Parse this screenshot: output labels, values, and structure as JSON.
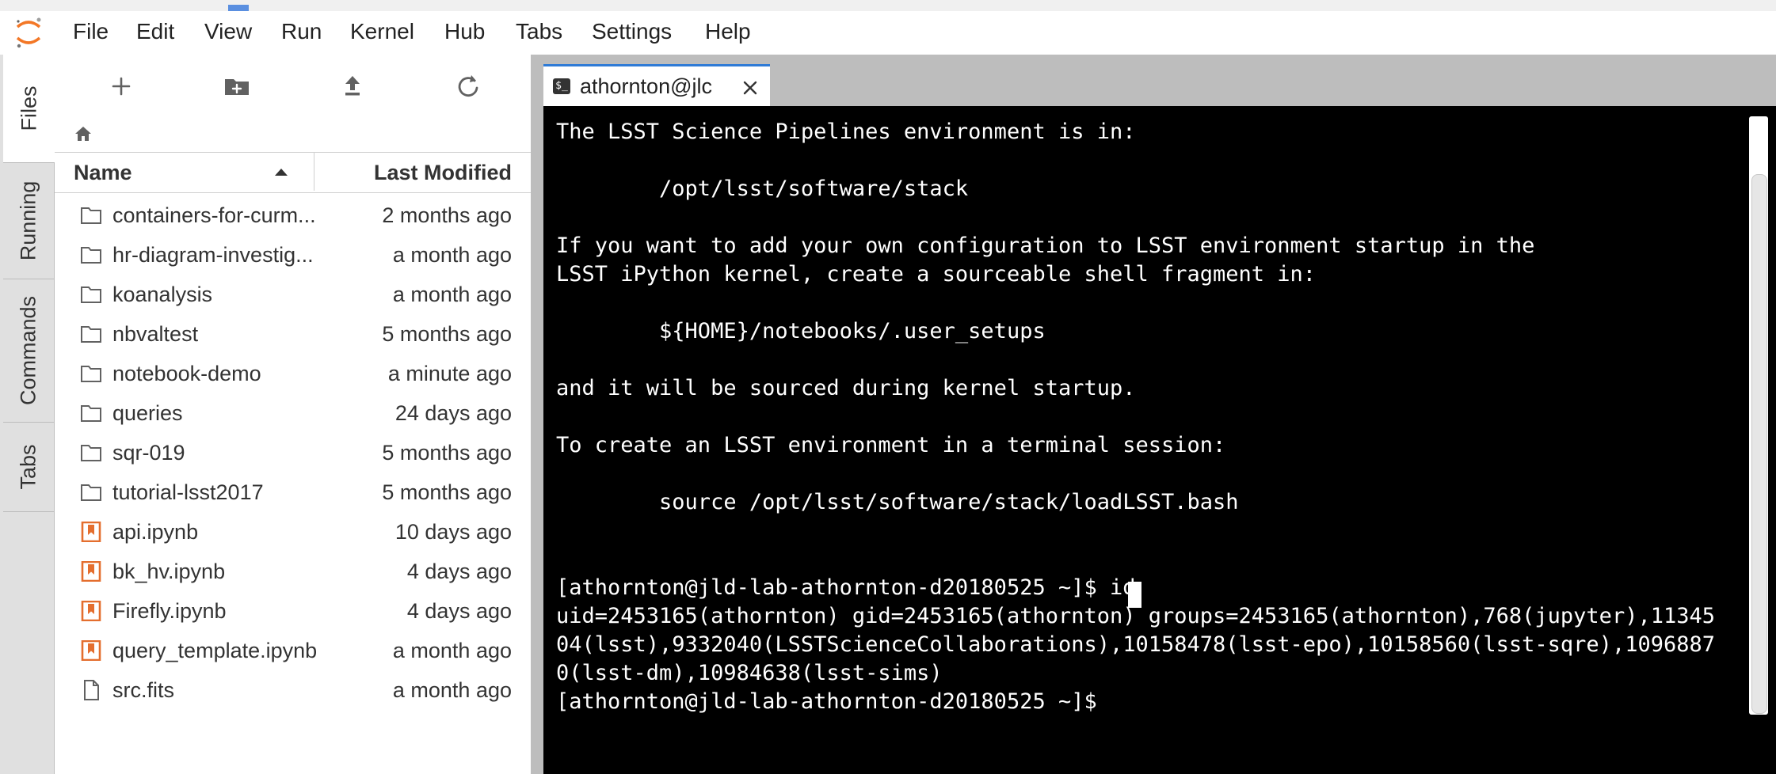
{
  "menubar": {
    "items": [
      "File",
      "Edit",
      "View",
      "Run",
      "Kernel",
      "Hub",
      "Tabs",
      "Settings",
      "Help"
    ]
  },
  "sidebar": {
    "tabs": [
      "Files",
      "Running",
      "Commands",
      "Tabs"
    ]
  },
  "file_browser": {
    "toolbar_icons": [
      "plus-icon",
      "new-folder-icon",
      "upload-icon",
      "refresh-icon"
    ],
    "columns": {
      "name": "Name",
      "modified": "Last Modified"
    },
    "files": [
      {
        "name": "containers-for-curm...",
        "modified": "2 months ago",
        "type": "folder"
      },
      {
        "name": "hr-diagram-investig...",
        "modified": "a month ago",
        "type": "folder"
      },
      {
        "name": "koanalysis",
        "modified": "a month ago",
        "type": "folder"
      },
      {
        "name": "nbvaltest",
        "modified": "5 months ago",
        "type": "folder"
      },
      {
        "name": "notebook-demo",
        "modified": "a minute ago",
        "type": "folder"
      },
      {
        "name": "queries",
        "modified": "24 days ago",
        "type": "folder"
      },
      {
        "name": "sqr-019",
        "modified": "5 months ago",
        "type": "folder"
      },
      {
        "name": "tutorial-lsst2017",
        "modified": "5 months ago",
        "type": "folder"
      },
      {
        "name": "api.ipynb",
        "modified": "10 days ago",
        "type": "notebook"
      },
      {
        "name": "bk_hv.ipynb",
        "modified": "4 days ago",
        "type": "notebook"
      },
      {
        "name": "Firefly.ipynb",
        "modified": "4 days ago",
        "type": "notebook"
      },
      {
        "name": "query_template.ipynb",
        "modified": "a month ago",
        "type": "notebook"
      },
      {
        "name": "src.fits",
        "modified": "a month ago",
        "type": "file"
      }
    ]
  },
  "doc_tab": {
    "label": "athornton@jlc"
  },
  "terminal": {
    "lines": [
      "The LSST Science Pipelines environment is in:",
      "",
      "        /opt/lsst/software/stack",
      "",
      "If you want to add your own configuration to LSST environment startup in the",
      "LSST iPython kernel, create a sourceable shell fragment in:",
      "",
      "        ${HOME}/notebooks/.user_setups",
      "",
      "and it will be sourced during kernel startup.",
      "",
      "To create an LSST environment in a terminal session:",
      "",
      "        source /opt/lsst/software/stack/loadLSST.bash",
      "",
      "",
      "[athornton@jld-lab-athornton-d20180525 ~]$ id",
      "uid=2453165(athornton) gid=2453165(athornton) groups=2453165(athornton),768(jupyter),11345",
      "04(lsst),9332040(LSSTScienceCollaborations),10158478(lsst-epo),10158560(lsst-sqre),1096887",
      "0(lsst-dm),10984638(lsst-sims)",
      "[athornton@jld-lab-athornton-d20180525 ~]$ "
    ]
  },
  "colors": {
    "accent": "#2f7bd6",
    "notebook_icon": "#e46e2e",
    "logo": "#f37726"
  }
}
